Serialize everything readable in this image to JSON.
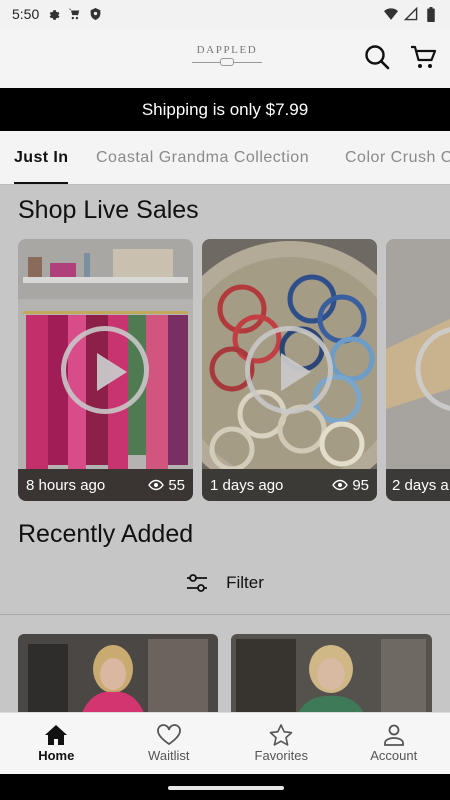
{
  "status_bar": {
    "time": "5:50"
  },
  "header": {
    "logo_text": "DAPPLED"
  },
  "banner": {
    "text": "Shipping is only $7.99"
  },
  "tabs": [
    {
      "label": "Just In",
      "active": true
    },
    {
      "label": "Coastal Grandma Collection",
      "active": false
    },
    {
      "label": "Color Crush C",
      "active": false
    }
  ],
  "live_sales": {
    "title": "Shop Live Sales",
    "cards": [
      {
        "time": "8 hours ago",
        "views": "55"
      },
      {
        "time": "1 days ago",
        "views": "95"
      },
      {
        "time": "2 days a",
        "views": ""
      }
    ]
  },
  "recently_added": {
    "title": "Recently Added",
    "filter_label": "Filter"
  },
  "bottom_nav": [
    {
      "label": "Home",
      "icon": "home-icon",
      "active": true
    },
    {
      "label": "Waitlist",
      "icon": "heart-icon",
      "active": false
    },
    {
      "label": "Favorites",
      "icon": "star-icon",
      "active": false
    },
    {
      "label": "Account",
      "icon": "person-icon",
      "active": false
    }
  ],
  "colors": {
    "banner_bg": "#000000",
    "overlay_bg": "#c6c6c6"
  }
}
